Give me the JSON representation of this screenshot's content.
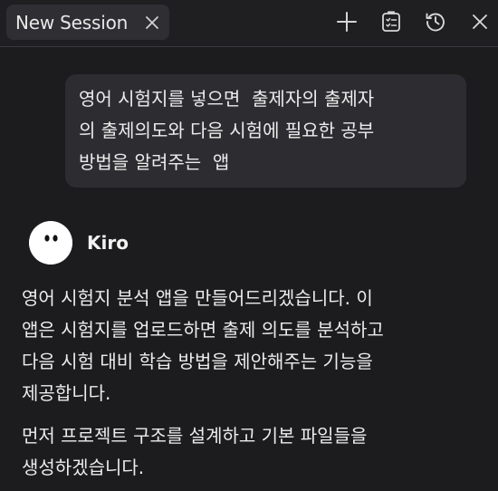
{
  "tabs": [
    {
      "label": "New Session"
    }
  ],
  "toolbar": {
    "icons": [
      "plus-icon",
      "task-list-icon",
      "history-icon",
      "close-icon"
    ]
  },
  "conversation": {
    "user_message": "영어 시험지를 넣으면  출제자의 출제자\n의 출제의도와 다음 시험에 필요한 공부\n방법을 알려주는  앱",
    "agent": {
      "name": "Kiro",
      "paragraphs": [
        "영어 시험지 분석 앱을 만들어드리겠습니다. 이\n앱은 시험지를 업로드하면 출제 의도를 분석하고\n다음 시험 대비 학습 방법을 제안해주는 기능을\n제공합니다.",
        "먼저 프로젝트 구조를 설계하고 기본 파일들을\n생성하겠습니다."
      ]
    }
  },
  "colors": {
    "background": "#1c1c1e",
    "tab_background": "#2f2f33",
    "bubble_background": "#2d2d31",
    "text": "#ececec",
    "icon": "#d6d6d6"
  }
}
